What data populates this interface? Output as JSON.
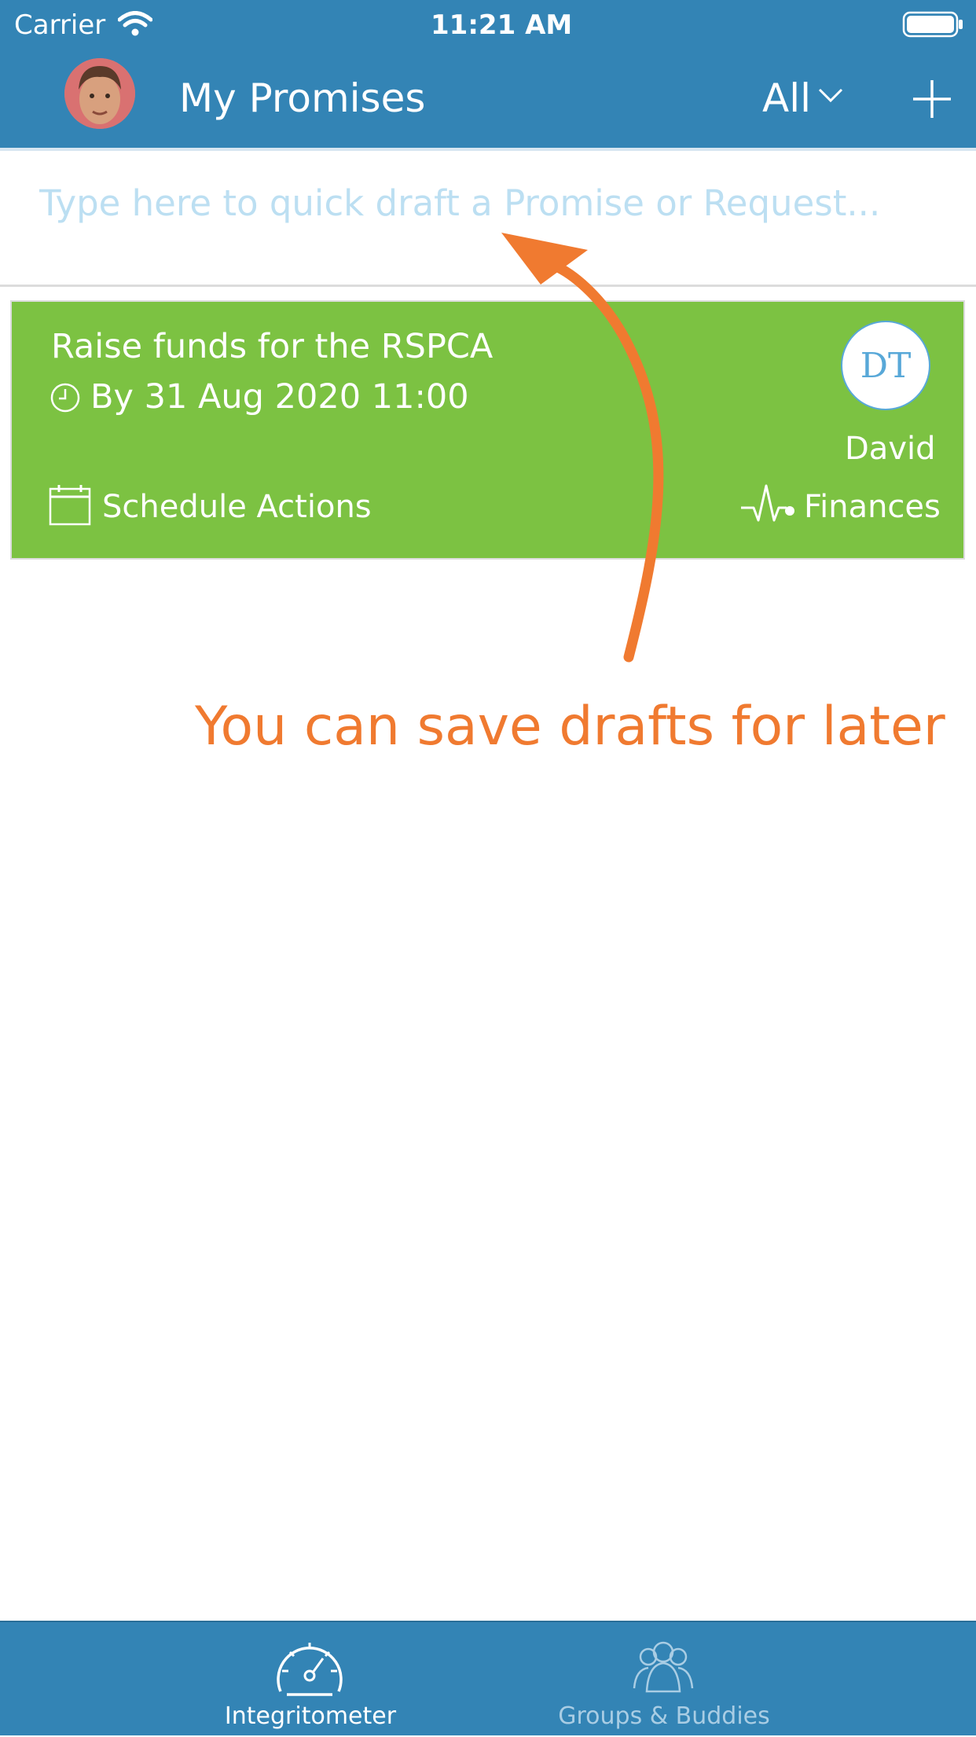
{
  "status_bar": {
    "carrier": "Carrier",
    "time": "11:21 AM"
  },
  "header": {
    "title": "My Promises",
    "filter": "All",
    "add_icon": "plus-icon"
  },
  "draft": {
    "placeholder": "Type here to quick draft a Promise or Request..."
  },
  "promise_card": {
    "title": "Raise funds for the RSPCA",
    "due": "By 31 Aug 2020 11:00",
    "owner_initials": "DT",
    "owner_name": "David",
    "action": "Schedule Actions",
    "area": "Finances",
    "color": "#7cc242"
  },
  "annotation": {
    "text": "You can save drafts for later",
    "color": "#f07a30"
  },
  "tabbar": {
    "tabs": [
      {
        "label": "Integritometer",
        "icon": "speedometer-icon",
        "active": true
      },
      {
        "label": "Groups & Buddies",
        "icon": "people-icon",
        "active": false
      }
    ]
  },
  "colors": {
    "header": "#3384b5",
    "accent": "#58a8d8"
  }
}
